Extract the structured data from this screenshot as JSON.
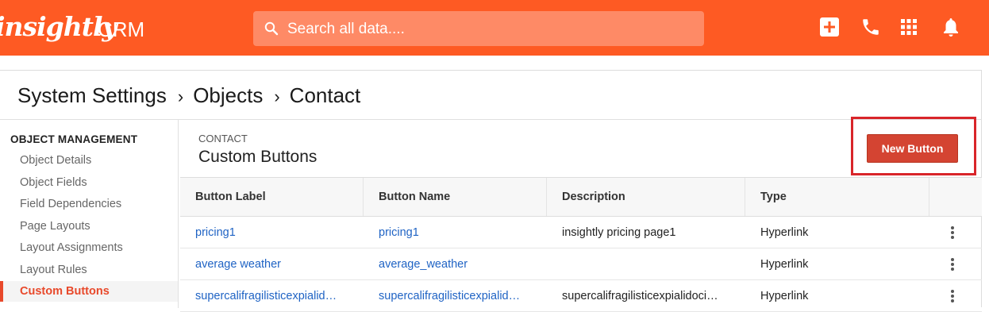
{
  "header": {
    "logo_text": "insightly",
    "app_name": "CRM",
    "search_placeholder": "Search all data....",
    "icons": [
      "search-icon",
      "add-icon",
      "phone-icon",
      "apps-grid-icon",
      "bell-icon"
    ],
    "brand_color": "#fe5a23"
  },
  "breadcrumb": {
    "items": [
      "System Settings",
      "Objects",
      "Contact"
    ],
    "separator": "›"
  },
  "sidebar": {
    "section_title": "OBJECT MANAGEMENT",
    "items": [
      {
        "label": "Object Details",
        "active": false
      },
      {
        "label": "Object Fields",
        "active": false
      },
      {
        "label": "Field Dependencies",
        "active": false
      },
      {
        "label": "Page Layouts",
        "active": false
      },
      {
        "label": "Layout Assignments",
        "active": false
      },
      {
        "label": "Layout Rules",
        "active": false
      },
      {
        "label": "Custom Buttons",
        "active": true
      }
    ],
    "active_color": "#e8492b"
  },
  "content": {
    "object_label": "CONTACT",
    "title": "Custom Buttons",
    "new_button_label": "New Button",
    "highlight_color": "#d9252a"
  },
  "table": {
    "columns": [
      "Button Label",
      "Button Name",
      "Description",
      "Type"
    ],
    "rows": [
      {
        "label": "pricing1",
        "name": "pricing1",
        "description": "insightly pricing page1",
        "type": "Hyperlink"
      },
      {
        "label": "average weather",
        "name": "average_weather",
        "description": "",
        "type": "Hyperlink"
      },
      {
        "label": "supercalifragilisticexpialid…",
        "name": "supercalifragilisticexpialid…",
        "description": "supercalifragilisticexpialidoci…",
        "type": "Hyperlink"
      }
    ],
    "link_color": "#1f63c4"
  }
}
